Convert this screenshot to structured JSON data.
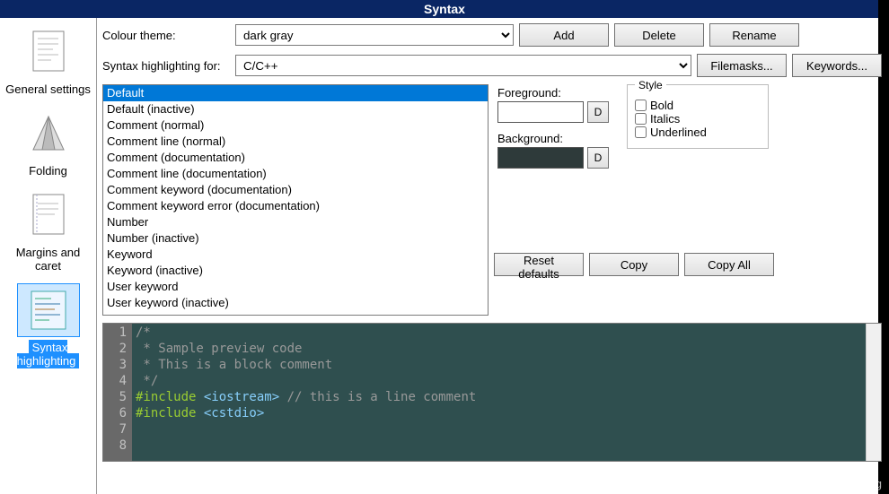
{
  "title": "Syntax",
  "sidebar": {
    "items": [
      {
        "label": "General settings"
      },
      {
        "label": "Folding"
      },
      {
        "label": "Margins and caret"
      },
      {
        "label": "Syntax highlighting"
      }
    ]
  },
  "theme_row": {
    "label": "Colour theme:",
    "value": "dark gray"
  },
  "lang_row": {
    "label": "Syntax highlighting for:",
    "value": "C/C++"
  },
  "buttons": {
    "add": "Add",
    "delete": "Delete",
    "rename": "Rename",
    "filemasks": "Filemasks...",
    "keywords": "Keywords...",
    "reset": "Reset defaults",
    "copy": "Copy",
    "copyall": "Copy All",
    "d": "D"
  },
  "list": [
    "Default",
    "Default (inactive)",
    "Comment (normal)",
    "Comment line (normal)",
    "Comment (documentation)",
    "Comment line (documentation)",
    "Comment keyword (documentation)",
    "Comment keyword error (documentation)",
    "Number",
    "Number (inactive)",
    "Keyword",
    "Keyword (inactive)",
    "User keyword",
    "User keyword (inactive)"
  ],
  "colors": {
    "fg_label": "Foreground:",
    "bg_label": "Background:"
  },
  "style": {
    "legend": "Style",
    "bold": "Bold",
    "italics": "Italics",
    "underlined": "Underlined"
  },
  "preview": {
    "lines": [
      "1",
      "2",
      "3",
      "4",
      "5",
      "6",
      "7",
      "8"
    ],
    "l1": "/*",
    "l2": " * Sample preview code",
    "l3": " * This is a block comment",
    "l4": " */",
    "l5": "",
    "pp1": "#include ",
    "inc1": "<iostream>",
    "lc1": " // this is a line comment",
    "pp2": "#include ",
    "inc2": "<cstdio>"
  },
  "watermark": "https://blog.csdn.net/nyist_yangguang"
}
